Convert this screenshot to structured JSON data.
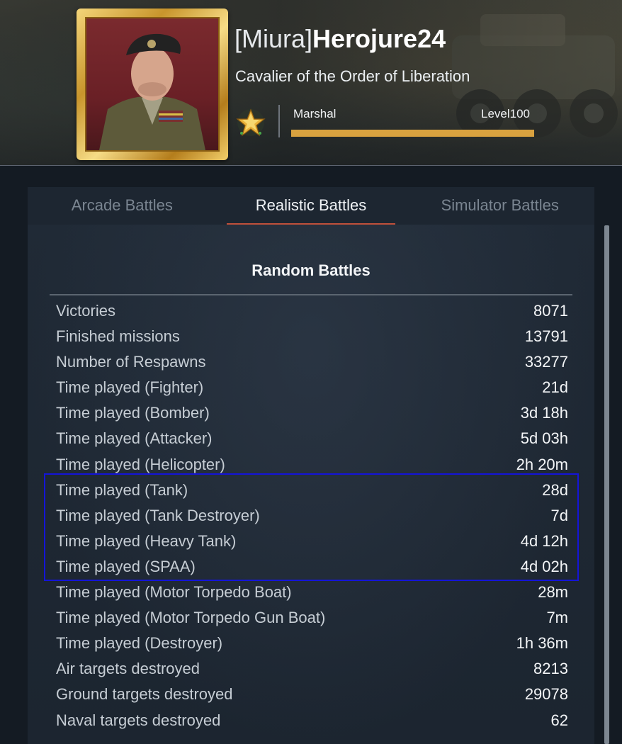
{
  "profile": {
    "clan_tag": "[Miura]",
    "nickname": "Herojure24",
    "title": "Cavalier of the Order of Liberation",
    "rank_name": "Marshal",
    "level_label": "Level",
    "level_value": "100",
    "xp_progress": 1.0
  },
  "tabs": [
    {
      "label": "Arcade Battles",
      "active": false
    },
    {
      "label": "Realistic Battles",
      "active": true
    },
    {
      "label": "Simulator Battles",
      "active": false
    }
  ],
  "section_title": "Random Battles",
  "stats": [
    {
      "label": "Victories",
      "value": "8071"
    },
    {
      "label": "Finished missions",
      "value": "13791"
    },
    {
      "label": "Number of Respawns",
      "value": "33277"
    },
    {
      "label": "Time played (Fighter)",
      "value": "21d"
    },
    {
      "label": "Time played (Bomber)",
      "value": "3d 18h"
    },
    {
      "label": "Time played (Attacker)",
      "value": "5d 03h"
    },
    {
      "label": "Time played (Helicopter)",
      "value": "2h 20m"
    },
    {
      "label": "Time played (Tank)",
      "value": "28d"
    },
    {
      "label": "Time played (Tank Destroyer)",
      "value": "7d"
    },
    {
      "label": "Time played (Heavy Tank)",
      "value": "4d 12h"
    },
    {
      "label": "Time played (SPAA)",
      "value": "4d 02h"
    },
    {
      "label": "Time played (Motor Torpedo Boat)",
      "value": "28m"
    },
    {
      "label": "Time played (Motor Torpedo Gun Boat)",
      "value": "7m"
    },
    {
      "label": "Time played (Destroyer)",
      "value": "1h 36m"
    },
    {
      "label": "Air targets destroyed",
      "value": "8213"
    },
    {
      "label": "Ground targets destroyed",
      "value": "29078"
    },
    {
      "label": "Naval targets destroyed",
      "value": "62"
    }
  ],
  "colors": {
    "accent_tab_underline": "#c0503a",
    "xp_bar": "#d9a23f",
    "highlight_box": "#1414d8"
  }
}
